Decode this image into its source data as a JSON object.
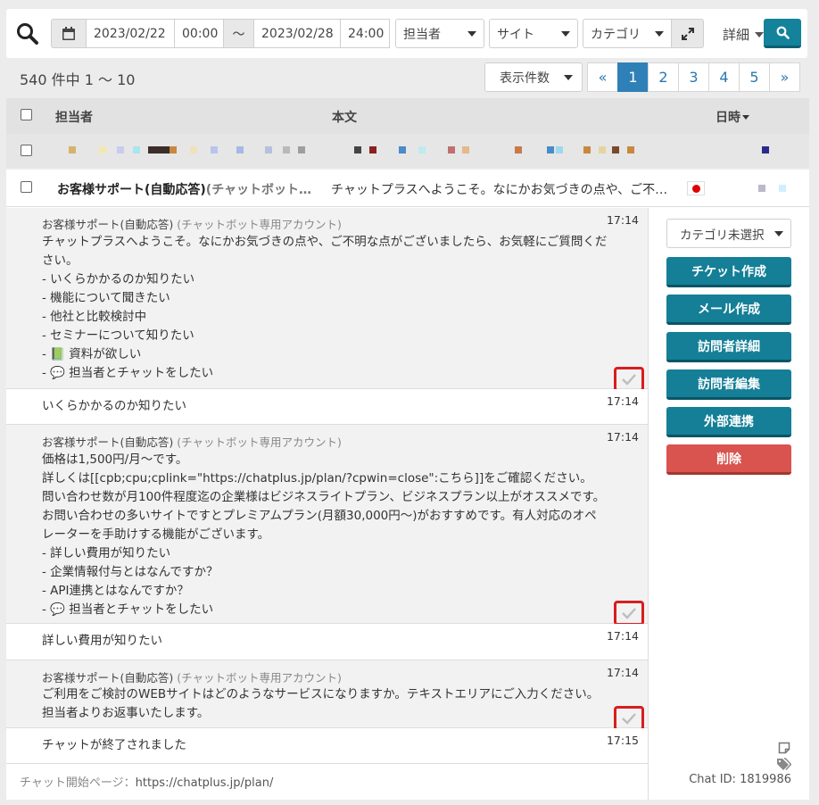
{
  "toolbar": {
    "date_from": "2023/02/22",
    "time_from": "00:00",
    "range_sep": "〜",
    "date_to": "2023/02/28",
    "time_to": "24:00",
    "assignee_select": "担当者",
    "site_select": "サイト",
    "category_select": "カテゴリ",
    "detail_label": "詳細"
  },
  "list": {
    "count_text": "540 件中 1 〜 10",
    "per_page_select": "表示件数",
    "pages": [
      "«",
      "1",
      "2",
      "3",
      "4",
      "5",
      "»"
    ],
    "active_page": "1"
  },
  "table": {
    "col_assignee": "担当者",
    "col_body": "本文",
    "col_datetime": "日時"
  },
  "chat": {
    "header_name": "お客様サポート(自動応答)",
    "header_account": "(チャットボット…",
    "header_preview": "チャットプラスへようこそ。なにかお気づきの点や、ご不…",
    "messages": [
      {
        "author": "お客様サポート(自動応答)",
        "account": "(チャットボット専用アカウント)",
        "time": "17:14",
        "text": "チャットプラスへようこそ。なにかお気づきの点や、ご不明な点がございましたら、お気軽にご質問くだ\nさい。\n- いくらかかるのか知りたい\n- 機能について聞きたい\n- 他社と比較検討中\n- セミナーについて知りたい\n- 📗 資料が欲しい\n- 💬 担当者とチャットをしたい"
      },
      {
        "time": "17:14",
        "text": "いくらかかるのか知りたい"
      },
      {
        "author": "お客様サポート(自動応答)",
        "account": "(チャットボット専用アカウント)",
        "time": "17:14",
        "text": "価格は1,500円/月〜です。\n詳しくは[[cpb;cpu;cplink=\"https://chatplus.jp/plan/?cpwin=close\":こちら]]をご確認ください。\n問い合わせ数が月100件程度迄の企業様はビジネスライトプラン、ビジネスプラン以上がオススメです。\nお問い合わせの多いサイトですとプレミアムプラン(月額30,000円〜)がおすすめです。有人対応のオペ\nレーターを手助けする機能がございます。\n- 詳しい費用が知りたい\n- 企業情報付与とはなんですか？\n- API連携とはなんですか？\n- 💬 担当者とチャットをしたい"
      },
      {
        "time": "17:14",
        "text": "詳しい費用が知りたい"
      },
      {
        "author": "お客様サポート(自動応答)",
        "account": "(チャットボット専用アカウント)",
        "time": "17:14",
        "text": "ご利用をご検討のWEBサイトはどのようなサービスになりますか。テキストエリアにご入力ください。\n担当者よりお返事いたします。"
      },
      {
        "time": "17:15",
        "text": "チャットが終了されました"
      }
    ],
    "start_page_label": "チャット開始ページ：",
    "start_page_url": "https://chatplus.jp/plan/"
  },
  "side": {
    "category_select": "カテゴリ未選択",
    "buttons": [
      "チケット作成",
      "メール作成",
      "訪問者詳細",
      "訪問者編集",
      "外部連携",
      "削除"
    ],
    "chat_id_label": "Chat ID:",
    "chat_id": "1819986"
  },
  "colors": {
    "primary": "#147f96",
    "danger": "#d9534f",
    "page_active": "#2f80b7",
    "highlight": "#d81e1e"
  }
}
